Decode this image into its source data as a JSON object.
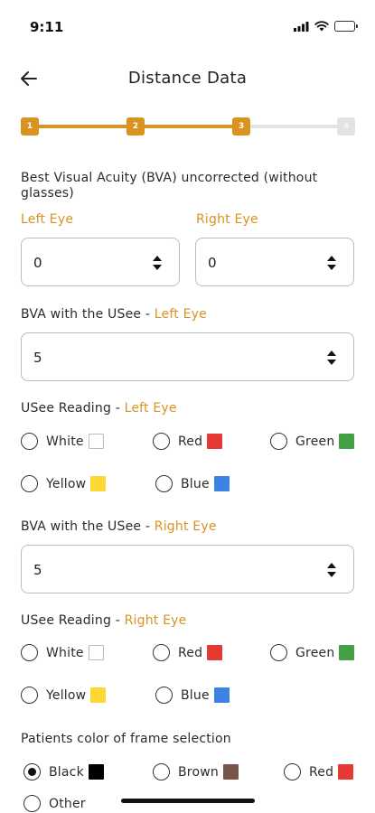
{
  "status": {
    "time": "9:11",
    "signal_icon": "signal-icon",
    "wifi_icon": "wifi-icon",
    "battery_icon": "battery-icon"
  },
  "header": {
    "title": "Distance Data",
    "back_icon": "arrow-left-icon"
  },
  "stepper": {
    "steps": [
      "1",
      "2",
      "3",
      "4"
    ],
    "current_step": 3,
    "active_color": "#d99321",
    "inactive_color": "#e3e3e3"
  },
  "uncorrected": {
    "title": "Best Visual Acuity (BVA) uncorrected (without glasses)",
    "left_label": "Left Eye",
    "right_label": "Right Eye",
    "left_value": "0",
    "right_value": "0"
  },
  "bva_left": {
    "label": "BVA with the USee - ",
    "eye": "Left Eye",
    "value": "5"
  },
  "reading_left": {
    "label": "USee Reading - ",
    "eye": "Left Eye",
    "options": [
      {
        "label": "White",
        "color": "#ffffff"
      },
      {
        "label": "Red",
        "color": "#e53935"
      },
      {
        "label": "Green",
        "color": "#43a047"
      },
      {
        "label": "Yellow",
        "color": "#fdd835"
      },
      {
        "label": "Blue",
        "color": "#3d83e6"
      }
    ]
  },
  "bva_right": {
    "label": "BVA with the USee - ",
    "eye": "Right Eye",
    "value": "5"
  },
  "reading_right": {
    "label": "USee Reading - ",
    "eye": "Right Eye",
    "options": [
      {
        "label": "White",
        "color": "#ffffff"
      },
      {
        "label": "Red",
        "color": "#e53935"
      },
      {
        "label": "Green",
        "color": "#43a047"
      },
      {
        "label": "Yellow",
        "color": "#fdd835"
      },
      {
        "label": "Blue",
        "color": "#3d83e6"
      }
    ]
  },
  "frame": {
    "label": "Patients color of frame selection",
    "selected": "Black",
    "options": [
      {
        "label": "Black",
        "color": "#000000"
      },
      {
        "label": "Brown",
        "color": "#795548"
      },
      {
        "label": "Red",
        "color": "#e53935"
      },
      {
        "label": "Other",
        "color": ""
      }
    ]
  },
  "colors": {
    "accent": "#d99321",
    "border": "#bdbdbd"
  }
}
